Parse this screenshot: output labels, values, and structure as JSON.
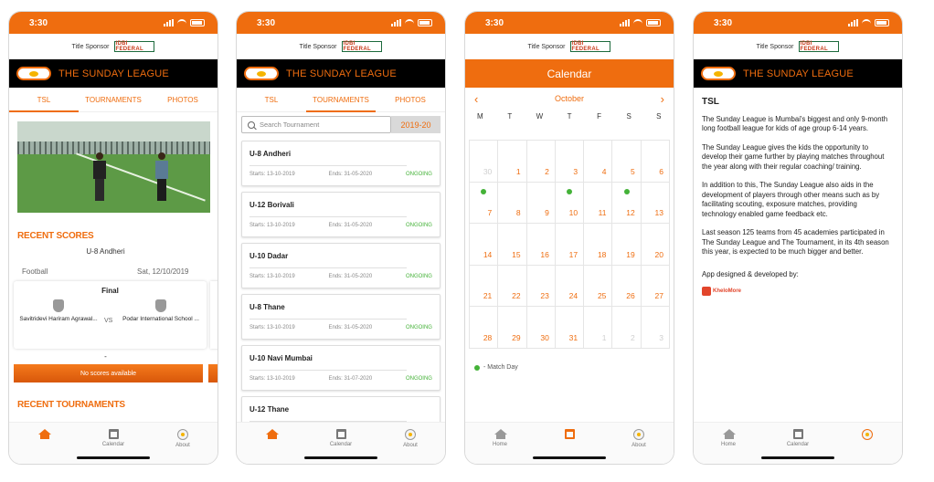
{
  "status": {
    "time": "3:30"
  },
  "sponsor": {
    "label": "Title Sponsor",
    "logo_text": "IDBI FEDERAL"
  },
  "league": {
    "title": "THE SUNDAY LEAGUE"
  },
  "tabs": [
    "TSL",
    "TOURNAMENTS",
    "PHOTOS"
  ],
  "nav": {
    "home": "Home",
    "calendar": "Calendar",
    "about": "About"
  },
  "tsl": {
    "recent_scores_title": "RECENT SCORES",
    "match_tournament": "U-8 Andheri",
    "sport": "Football",
    "date": "Sat, 12/10/2019",
    "stage": "Final",
    "team1": "Savitridevi Hariram Agrawal...",
    "vs": "VS",
    "team2": "Podar International School ...",
    "dash": "-",
    "no_scores": "No scores available",
    "recent_tournaments_title": "RECENT TOURNAMENTS"
  },
  "tournaments": {
    "search_placeholder": "Search Tournament",
    "year": "2019-20",
    "list": [
      {
        "name": "U-8 Andheri",
        "starts": "Starts: 13-10-2019",
        "ends": "Ends: 31-05-2020",
        "status": "ONGOING"
      },
      {
        "name": "U-12 Borivali",
        "starts": "Starts: 13-10-2019",
        "ends": "Ends: 31-05-2020",
        "status": "ONGOING"
      },
      {
        "name": "U-10 Dadar",
        "starts": "Starts: 13-10-2019",
        "ends": "Ends: 31-05-2020",
        "status": "ONGOING"
      },
      {
        "name": "U-8 Thane",
        "starts": "Starts: 13-10-2019",
        "ends": "Ends: 31-05-2020",
        "status": "ONGOING"
      },
      {
        "name": "U-10 Navi Mumbai",
        "starts": "Starts: 13-10-2019",
        "ends": "Ends: 31-07-2020",
        "status": "ONGOING"
      },
      {
        "name": "U-12 Thane",
        "starts": "",
        "ends": "",
        "status": ""
      }
    ]
  },
  "calendar": {
    "header": "Calendar",
    "month": "October",
    "prev": "‹",
    "next": "›",
    "weekdays": [
      "M",
      "T",
      "W",
      "T",
      "F",
      "S",
      "S"
    ],
    "days": [
      {
        "d": "30",
        "m": true
      },
      {
        "d": "1"
      },
      {
        "d": "2"
      },
      {
        "d": "3"
      },
      {
        "d": "4"
      },
      {
        "d": "5"
      },
      {
        "d": "6"
      },
      {
        "d": "7",
        "dot": true
      },
      {
        "d": "8"
      },
      {
        "d": "9"
      },
      {
        "d": "10",
        "dot": true
      },
      {
        "d": "11"
      },
      {
        "d": "12",
        "dot": true
      },
      {
        "d": "13"
      },
      {
        "d": "14"
      },
      {
        "d": "15"
      },
      {
        "d": "16"
      },
      {
        "d": "17"
      },
      {
        "d": "18"
      },
      {
        "d": "19"
      },
      {
        "d": "20"
      },
      {
        "d": "21"
      },
      {
        "d": "22"
      },
      {
        "d": "23"
      },
      {
        "d": "24"
      },
      {
        "d": "25"
      },
      {
        "d": "26"
      },
      {
        "d": "27"
      },
      {
        "d": "28"
      },
      {
        "d": "29"
      },
      {
        "d": "30"
      },
      {
        "d": "31"
      },
      {
        "d": "1",
        "m": true
      },
      {
        "d": "2",
        "m": true
      },
      {
        "d": "3",
        "m": true
      }
    ],
    "legend": "- Match Day"
  },
  "about": {
    "heading": "TSL",
    "paragraphs": [
      "The Sunday League is Mumbai's biggest and only 9-month long football league for kids of age group 6-14 years.",
      "The Sunday League gives the kids the opportunity to develop their game further by playing matches throughout the year along with their regular coaching/ training.",
      "In addition to this, The Sunday League also aids in the development of players through other means such as by facilitating scouting, exposure matches, providing technology enabled game feedback etc.",
      "Last season 125 teams from 45 academies participated in The Sunday League and The Tournament, in its 4th season this year, is expected to be much bigger and better."
    ],
    "credit": "App designed & developed by:",
    "developer": "KheloMore"
  },
  "colors": {
    "accent": "#ef6d0f",
    "ongoing": "#44b238",
    "black_bar": "#000000"
  }
}
